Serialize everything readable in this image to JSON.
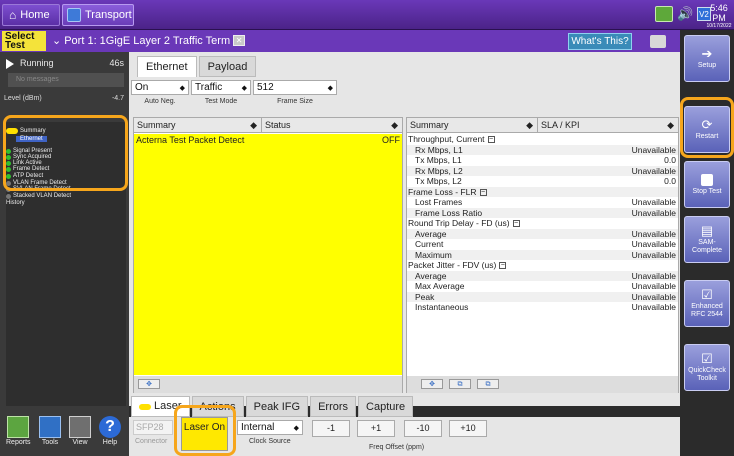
{
  "topbar": {
    "home_label": "Home",
    "transport_label": "Transport",
    "v2_label": "V2",
    "time": "5:46 PM",
    "date": "10/17/2022"
  },
  "titlebar": {
    "select_test_label": "Select Test",
    "port_title": "Port 1: 1GigE Layer 2 Traffic Term",
    "whats_this_label": "What's This?"
  },
  "left": {
    "status_label": "Running",
    "elapsed": "46s",
    "no_messages": "No messages",
    "level_label": "Level (dBm)",
    "level_value": "-4.7",
    "tree": [
      {
        "label": "Summary",
        "kind": "summary"
      },
      {
        "label": "Ethernet",
        "kind": "selected"
      },
      {
        "label": "Signal Present",
        "kind": "green"
      },
      {
        "label": "Sync Acquired",
        "kind": "green"
      },
      {
        "label": "Link Active",
        "kind": "green"
      },
      {
        "label": "Frame Detect",
        "kind": "green"
      },
      {
        "label": "ATP Detect",
        "kind": "green"
      },
      {
        "label": "VLAN Frame Detect",
        "kind": "grey"
      },
      {
        "label": "SVLAN Frame Detect",
        "kind": "grey"
      },
      {
        "label": "Stacked VLAN Detect",
        "kind": "grey"
      },
      {
        "label": "History",
        "kind": "plain"
      }
    ]
  },
  "config": {
    "tabs": [
      "Ethernet",
      "Payload"
    ],
    "auto_neg_value": "On",
    "auto_neg_label": "Auto Neg.",
    "test_mode_value": "Traffic",
    "test_mode_label": "Test Mode",
    "frame_size_value": "512",
    "frame_size_label": "Frame Size"
  },
  "left_table": {
    "col1": "Summary",
    "col2": "Status",
    "rows": [
      {
        "name": "Acterna Test Packet Detect",
        "value": "OFF"
      }
    ]
  },
  "right_table": {
    "col1": "Summary",
    "col2": "SLA / KPI",
    "rows": [
      {
        "label": "Throughput, Current",
        "value": "",
        "group": true
      },
      {
        "label": "Rx Mbps, L1",
        "value": "Unavailable",
        "group": false
      },
      {
        "label": "Tx Mbps, L1",
        "value": "0.0",
        "group": false
      },
      {
        "label": "Rx Mbps, L2",
        "value": "Unavailable",
        "group": false
      },
      {
        "label": "Tx Mbps, L2",
        "value": "0.0",
        "group": false
      },
      {
        "label": "Frame Loss - FLR",
        "value": "",
        "group": true
      },
      {
        "label": "Lost Frames",
        "value": "Unavailable",
        "group": false
      },
      {
        "label": "Frame Loss Ratio",
        "value": "Unavailable",
        "group": false
      },
      {
        "label": "Round Trip Delay - FD (us)",
        "value": "",
        "group": true
      },
      {
        "label": "Average",
        "value": "Unavailable",
        "group": false
      },
      {
        "label": "Current",
        "value": "Unavailable",
        "group": false
      },
      {
        "label": "Maximum",
        "value": "Unavailable",
        "group": false
      },
      {
        "label": "Packet Jitter - FDV (us)",
        "value": "",
        "group": true
      },
      {
        "label": "Average",
        "value": "Unavailable",
        "group": false
      },
      {
        "label": "Max Average",
        "value": "Unavailable",
        "group": false
      },
      {
        "label": "Peak",
        "value": "Unavailable",
        "group": false
      },
      {
        "label": "Instantaneous",
        "value": "Unavailable",
        "group": false
      }
    ]
  },
  "bottom": {
    "tabs": [
      "Laser",
      "Actions",
      "Peak IFG",
      "Errors",
      "Capture"
    ],
    "sfp_value": "SFP28",
    "connector_label": "Connector",
    "laser_on_label": "Laser On",
    "clock_value": "Internal",
    "clock_label": "Clock Source",
    "freq_buttons": [
      "-1",
      "+1",
      "-10",
      "+10"
    ],
    "freq_label": "Freq Offset (ppm)"
  },
  "nav": {
    "reports": "Reports",
    "tools": "Tools",
    "view": "View",
    "help": "Help"
  },
  "actions": {
    "setup": "Setup",
    "restart": "Restart",
    "stop_test": "Stop Test",
    "sam_complete": "SAM-Complete",
    "enhanced_rfc": "Enhanced RFC 2544",
    "quickcheck": "QuickCheck Toolkit"
  },
  "colors": {
    "accent_purple": "#6a38b8",
    "highlight_orange": "#f6a61c",
    "status_yellow": "#ffff00",
    "status_green": "#2ec02e"
  }
}
